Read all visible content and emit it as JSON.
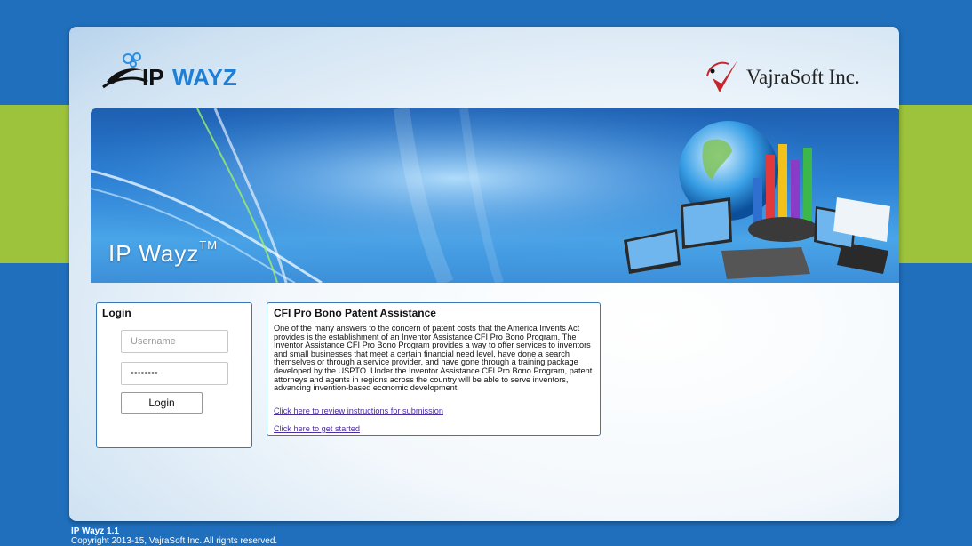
{
  "header": {
    "logo_left_text": "IPWAYZ",
    "logo_right_text": "VajraSoft Inc."
  },
  "banner": {
    "title": "IP Wayz",
    "trademark": "TM"
  },
  "login": {
    "title": "Login",
    "username_placeholder": "Username",
    "password_value": "••••••••",
    "button_label": "Login"
  },
  "info": {
    "title": "CFI Pro Bono Patent Assistance",
    "body": "One of the many answers to the concern of patent costs that the America Invents Act provides is the establishment of an Inventor Assistance CFI Pro Bono Program. The Inventor Assistance CFI Pro Bono Program provides a way to offer services to inventors and small businesses that meet a certain financial need level, have done a search themselves or through a service provider, and have gone through a training package developed by the USPTO. Under the Inventor Assistance CFI Pro Bono Program, patent attorneys and agents in regions across the country will be able to serve inventors, advancing invention-based economic development.",
    "link_instructions": "Click here to review instructions for submission",
    "link_get_started": "Click here to get started"
  },
  "footer": {
    "version": "IP Wayz 1.1",
    "copyright": "Copyright 2013-15, VajraSoft Inc. All rights reserved."
  },
  "colors": {
    "page_bg": "#1f6fbd",
    "green_band": "#9cc33b",
    "box_border": "#3a78b5",
    "link": "#4b2fa0"
  }
}
